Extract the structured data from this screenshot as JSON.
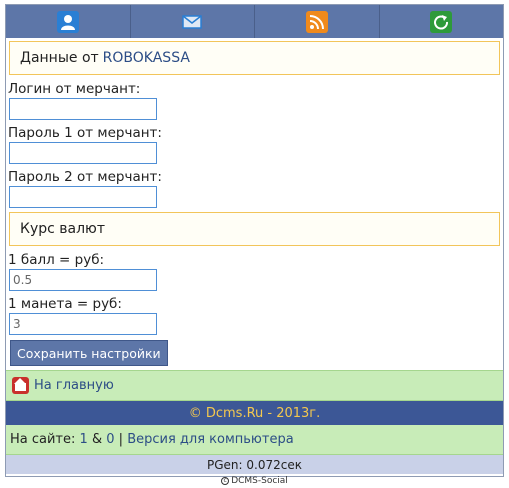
{
  "nav": {
    "items": [
      {
        "icon": "user-icon",
        "color": "#2a7fd4"
      },
      {
        "icon": "mail-icon",
        "color": "#2a7fd4"
      },
      {
        "icon": "rss-icon",
        "color": "#f08a1c"
      },
      {
        "icon": "refresh-icon",
        "color": "#2e9a3a"
      }
    ]
  },
  "robokassa": {
    "title_prefix": "Данные от",
    "title_accent": "ROBOKASSA",
    "login_label": "Логин от мерчант:",
    "login_value": "",
    "pass1_label": "Пароль 1 от мерчант:",
    "pass1_value": "",
    "pass2_label": "Пароль 2 от мерчант:",
    "pass2_value": ""
  },
  "rates": {
    "title": "Курс валют",
    "point_label": "1 балл = руб:",
    "point_value": "0.5",
    "coin_label": "1 манета = руб:",
    "coin_value": "3"
  },
  "save_label": "Сохранить настройки",
  "home_link": "На главную",
  "footer": {
    "copyright": "© Dcms.Ru - 2013г.",
    "online_prefix": "На сайте:",
    "online_users": "1",
    "online_amp": "&",
    "online_guests": "0",
    "separator": "|",
    "desktop_link": "Версия для компьютера",
    "pgen": "PGen: 0.072сек",
    "social": "DCMS-Social"
  },
  "colors": {
    "nav_bg": "#5d76a8",
    "accent_text": "#2c4d86",
    "green_bar": "#c8ecb8",
    "copyright_bg": "#3c5796",
    "copyright_text": "#f3c84f"
  }
}
